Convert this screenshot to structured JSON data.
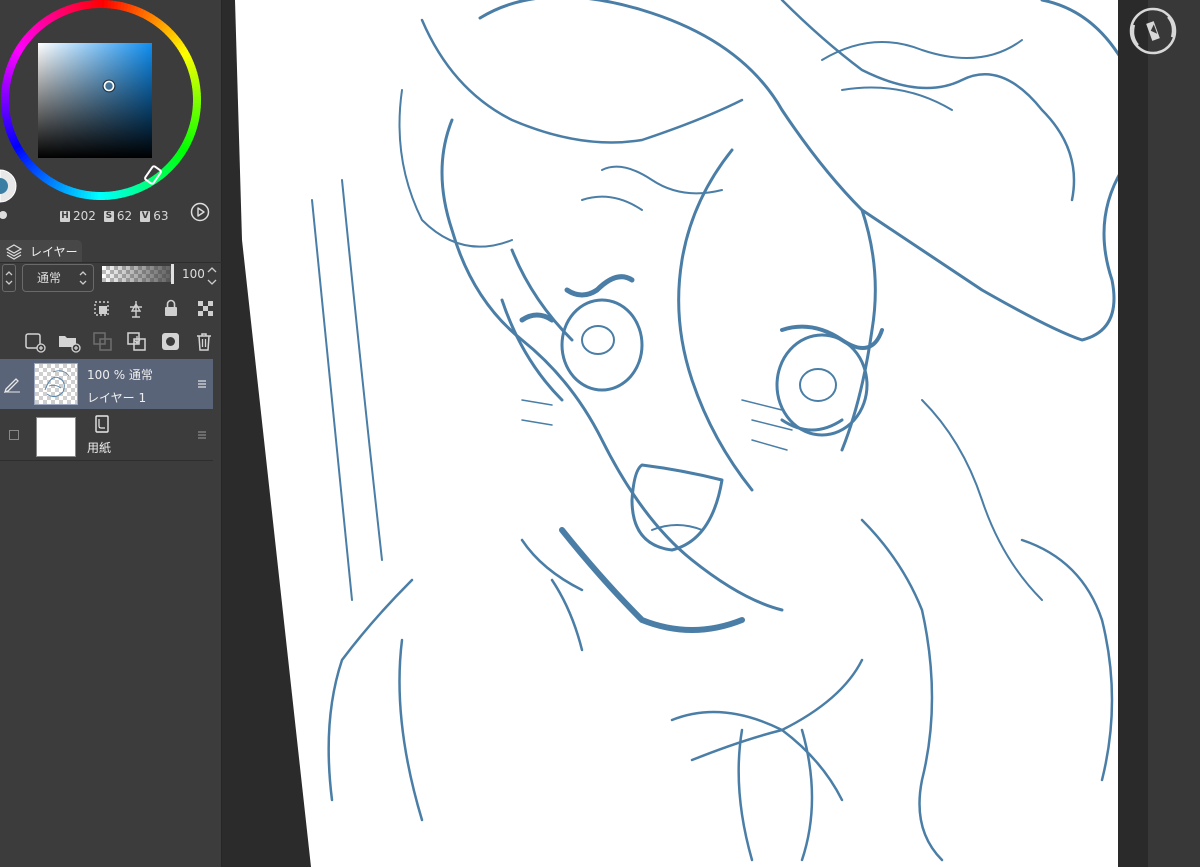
{
  "color": {
    "h": 202,
    "s": 62,
    "v": 63,
    "h_key": "H",
    "s_key": "S",
    "v_key": "V",
    "current_color": "#3a7fa3"
  },
  "layer_panel": {
    "tab_label": "レイヤー",
    "blend_mode": "通常",
    "opacity": 100,
    "opacity_display": "100"
  },
  "layers": [
    {
      "name": "レイヤー 1",
      "info": "100 % 通常",
      "selected": true
    },
    {
      "name": "用紙",
      "selected": false
    }
  ],
  "icons": {
    "layers_tab": "layers-stack-icon",
    "play": "play-circle-icon",
    "rotate_reset": "canvas-rotate-reset-icon",
    "pen": "pen-icon",
    "menu": "hamburger-icon",
    "paper": "paper-icon"
  },
  "theme": {
    "panel_bg": "#3c3c3c",
    "selected_row": "#5a6479",
    "stroke_color": "#4a7ea6"
  }
}
